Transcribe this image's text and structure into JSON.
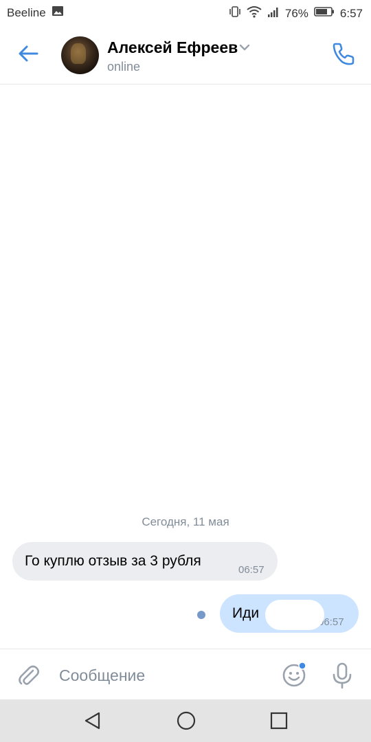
{
  "status_bar": {
    "carrier": "Beeline",
    "battery": "76%",
    "time": "6:57",
    "icons": [
      "image-icon",
      "vibrate-icon",
      "wifi-icon",
      "signal-icon",
      "battery-icon"
    ]
  },
  "header": {
    "contact_name": "Алексей Ефреев",
    "status": "online",
    "icons": [
      "back-arrow-icon",
      "chevron-down-icon",
      "phone-icon"
    ]
  },
  "chat": {
    "date_separator": "Сегодня, 11 мая",
    "messages": [
      {
        "direction": "incoming",
        "text": "Го куплю отзыв за 3 рубля",
        "time": "06:57"
      },
      {
        "direction": "outgoing",
        "text": "Иди",
        "time": "06:57",
        "unread": true
      }
    ]
  },
  "composer": {
    "placeholder": "Сообщение",
    "icons": [
      "paperclip-icon",
      "emoji-icon",
      "microphone-icon"
    ]
  },
  "nav_bar": {
    "icons": [
      "nav-back-icon",
      "nav-home-icon",
      "nav-recent-icon"
    ]
  },
  "colors": {
    "accent": "#3f8ae0",
    "secondary_text": "#818c99",
    "incoming_bubble": "#ebedf0",
    "outgoing_bubble": "#cce4ff",
    "unread_dot": "#7799c9"
  }
}
